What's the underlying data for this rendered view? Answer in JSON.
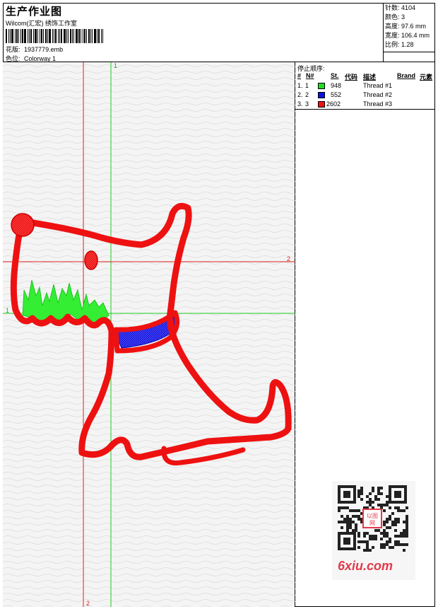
{
  "header": {
    "title": "生产作业图",
    "company": "Wilcom(汇宏) 绣饰工作室",
    "design_file_label": "花版:",
    "design_file": "1937779.emb",
    "colorway_label": "色位:",
    "colorway": "Colorway 1"
  },
  "stats": [
    {
      "label": "针数:",
      "value": "4104"
    },
    {
      "label": "颜色:",
      "value": "3"
    },
    {
      "label": "高度:",
      "value": "97.6 mm"
    },
    {
      "label": "宽度:",
      "value": "106.4 mm"
    },
    {
      "label": "比例:",
      "value": "1.28"
    }
  ],
  "stop_sequence": {
    "title": "停止顺序:",
    "columns": [
      "#",
      "N#",
      "St.",
      "代码",
      "描述",
      "Brand",
      "元素"
    ],
    "rows": [
      {
        "num": "1.",
        "n": "1",
        "color": "#22dd22",
        "code": "948",
        "desc": "Thread #1"
      },
      {
        "num": "2.",
        "n": "2",
        "color": "#1010dd",
        "code": "552",
        "desc": "Thread #2"
      },
      {
        "num": "3.",
        "n": "3",
        "color": "#ee1111",
        "code": "2602",
        "desc": "Thread #3"
      }
    ]
  },
  "guides": {
    "green_vertical_label": "1",
    "green_horizontal_label": "1",
    "red_horizontal_label": "2",
    "red_vertical_label": "2"
  },
  "watermark": {
    "site": "6xiu.com",
    "seal": "以图网",
    "brand_color": "#e33a4a"
  },
  "colors": {
    "red_thread": "#ee1111",
    "green_thread": "#22dd22",
    "blue_thread": "#1010dd"
  }
}
